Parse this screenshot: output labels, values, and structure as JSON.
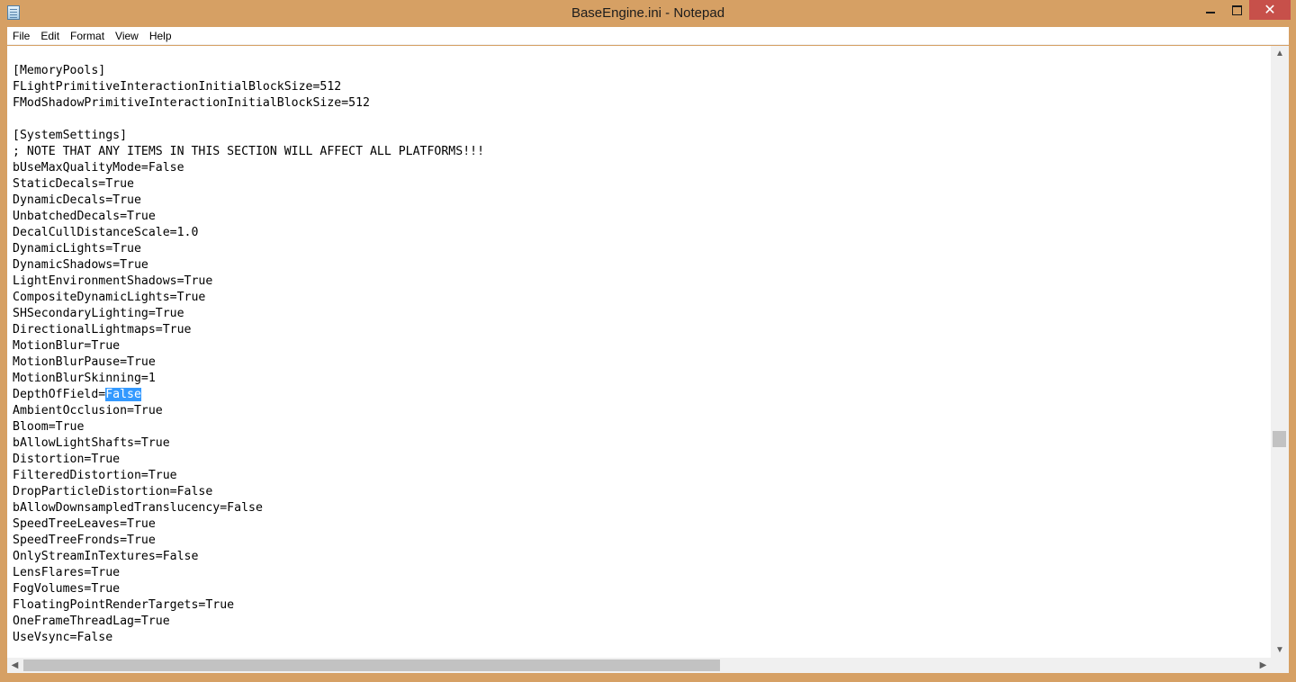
{
  "window": {
    "title": "BaseEngine.ini - Notepad",
    "icon": "notepad-icon",
    "controls": {
      "minimize": "minimize-icon",
      "maximize": "maximize-icon",
      "close": "✕"
    }
  },
  "menu": {
    "file": "File",
    "edit": "Edit",
    "format": "Format",
    "view": "View",
    "help": "Help"
  },
  "editor": {
    "lines": [
      "",
      "[MemoryPools]",
      "FLightPrimitiveInteractionInitialBlockSize=512",
      "FModShadowPrimitiveInteractionInitialBlockSize=512",
      "",
      "[SystemSettings]",
      "; NOTE THAT ANY ITEMS IN THIS SECTION WILL AFFECT ALL PLATFORMS!!!",
      "bUseMaxQualityMode=False",
      "StaticDecals=True",
      "DynamicDecals=True",
      "UnbatchedDecals=True",
      "DecalCullDistanceScale=1.0",
      "DynamicLights=True",
      "DynamicShadows=True",
      "LightEnvironmentShadows=True",
      "CompositeDynamicLights=True",
      "SHSecondaryLighting=True",
      "DirectionalLightmaps=True",
      "MotionBlur=True",
      "MotionBlurPause=True",
      "MotionBlurSkinning=1",
      "DepthOfField=",
      "AmbientOcclusion=True",
      "Bloom=True",
      "bAllowLightShafts=True",
      "Distortion=True",
      "FilteredDistortion=True",
      "DropParticleDistortion=False",
      "bAllowDownsampledTranslucency=False",
      "SpeedTreeLeaves=True",
      "SpeedTreeFronds=True",
      "OnlyStreamInTextures=False",
      "LensFlares=True",
      "FogVolumes=True",
      "FloatingPointRenderTargets=True",
      "OneFrameThreadLag=True",
      "UseVsync=False"
    ],
    "selected_text": "False",
    "selected_line_index": 21
  },
  "scrollbars": {
    "vertical_position": 0.63,
    "horizontal_position": 0.0,
    "up_arrow": "▲",
    "down_arrow": "▼",
    "left_arrow": "◀",
    "right_arrow": "▶"
  }
}
